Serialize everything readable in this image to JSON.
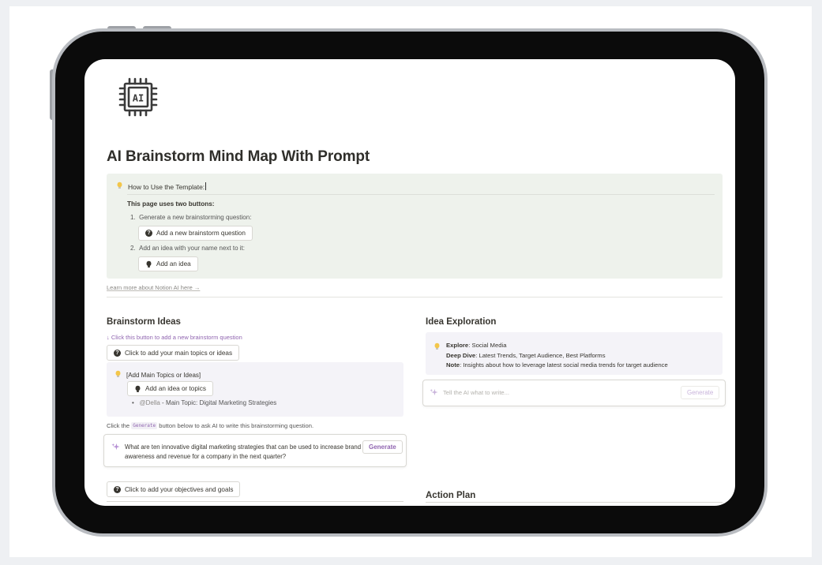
{
  "page": {
    "title": "AI Brainstorm Mind Map With Prompt",
    "logo_icon": "ai-chip-icon",
    "logo_text": "AI"
  },
  "howto": {
    "title": "How to Use the Template:",
    "intro": "This page uses two buttons:",
    "step1": "Generate a new brainstorming question:",
    "step1_button": "Add a new brainstorm question",
    "step2": "Add an idea with your name next to it:",
    "step2_button": "Add an idea",
    "step1_num": "1.",
    "step2_num": "2."
  },
  "learn_more": "Learn more about Notion AI here →",
  "brainstorm": {
    "heading": "Brainstorm Ideas",
    "hint": "↓ Click this button to add a new brainstorm question",
    "topics_button": "Click to add your main topics or ideas",
    "topics_title": "[Add Main Topics or Ideas]",
    "add_idea_button": "Add an idea or topics",
    "mention": "@Della",
    "bullet_text": " - Main Topic: Digital Marketing Strategies",
    "gen_note_before": "Click the ",
    "gen_note_code": "Generate",
    "gen_note_after": " button below to ask AI to write this brainstorming question.",
    "ai_question": "What are ten innovative digital marketing strategies that can be used to increase brand awareness and revenue for a company in the next quarter?",
    "generate_label": "Generate",
    "objectives_button": "Click to add your objectives and goals"
  },
  "exploration": {
    "heading": "Idea Exploration",
    "explore_label": "Explore",
    "explore_value": ": Social Media",
    "deep_label": "Deep Dive",
    "deep_value": ": Latest Trends, Target Audience, Best Platforms",
    "note_label": "Note",
    "note_value": ": Insights about how to leverage latest social media trends for target audience",
    "ai_placeholder": "Tell the AI what to write...",
    "generate_label": "Generate"
  },
  "action_plan": {
    "heading": "Action Plan"
  }
}
